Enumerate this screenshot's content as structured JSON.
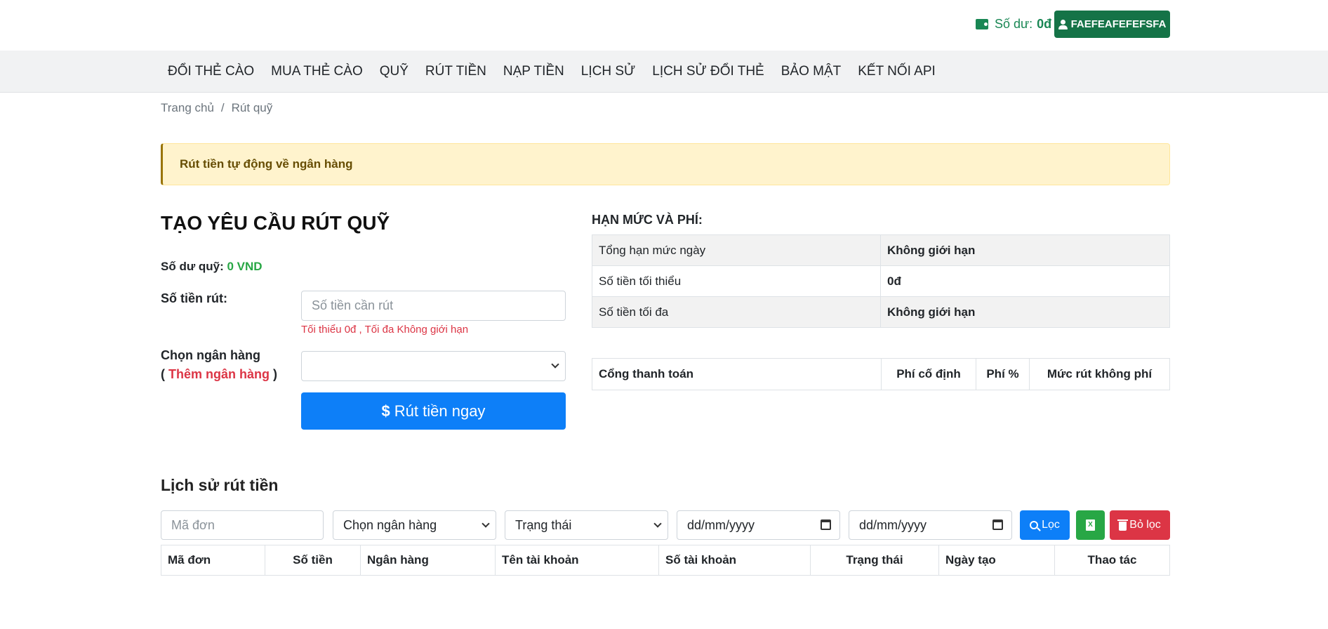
{
  "header": {
    "balance_label": "Số dư:",
    "balance_value": "0đ",
    "username": "FAEFEAFEFEFSFA",
    "wallet_icon": "wallet-icon",
    "user_icon": "user-icon"
  },
  "nav": {
    "items": [
      {
        "label": "ĐỔI THẺ CÀO"
      },
      {
        "label": "MUA THẺ CÀO"
      },
      {
        "label": "QUỸ"
      },
      {
        "label": "RÚT TIỀN"
      },
      {
        "label": "NẠP TIỀN"
      },
      {
        "label": "LỊCH SỬ"
      },
      {
        "label": "LỊCH SỬ ĐỔI THẺ"
      },
      {
        "label": "BẢO MẬT"
      },
      {
        "label": "KẾT NỐI API"
      }
    ]
  },
  "breadcrumb": {
    "home": "Trang chủ",
    "separator": "/",
    "current": "Rút quỹ"
  },
  "alert": {
    "text": "Rút tiền tự động về ngân hàng",
    "color": "#fff3cd"
  },
  "form": {
    "title": "TẠO YÊU CẦU RÚT QUỸ",
    "fund_balance_label": "Số dư quỹ:",
    "fund_balance_value": "0 VND",
    "amount_label": "Số tiền rút:",
    "amount_placeholder": "Số tiền cần rút",
    "amount_hint": "Tối thiểu 0đ , Tối đa Không giới hạn",
    "bank_label": "Chọn ngân hàng",
    "add_bank_open": "( ",
    "add_bank_link": "Thêm ngân hàng",
    "add_bank_close": " )",
    "bank_selected": "",
    "submit_icon": "$",
    "submit_label": "Rút tiền ngay",
    "submit_color": "#0d7ff8"
  },
  "limits": {
    "title": "HẠN MỨC VÀ PHÍ:",
    "rows": [
      {
        "label": "Tổng hạn mức ngày",
        "value": "Không giới hạn"
      },
      {
        "label": "Số tiền tối thiểu",
        "value": "0đ"
      },
      {
        "label": "Số tiền tối đa",
        "value": "Không giới hạn"
      }
    ],
    "gateway_headers": [
      "Cổng thanh toán",
      "Phí cố định",
      "Phí %",
      "Mức rút không phí"
    ]
  },
  "history": {
    "title": "Lịch sử rút tiền",
    "filters": {
      "order_placeholder": "Mã đơn",
      "bank_select": "Chọn ngân hàng",
      "status_select": "Trạng thái",
      "date_from": "dd/mm/yyyy",
      "date_to": "dd/mm/yyyy"
    },
    "buttons": {
      "filter": "Lọc",
      "excel_icon": "X",
      "clear": "Bỏ lọc"
    },
    "columns": [
      "Mã đơn",
      "Số tiền",
      "Ngân hàng",
      "Tên tài khoản",
      "Số tài khoản",
      "Trạng thái",
      "Ngày tạo",
      "Thao tác"
    ]
  }
}
